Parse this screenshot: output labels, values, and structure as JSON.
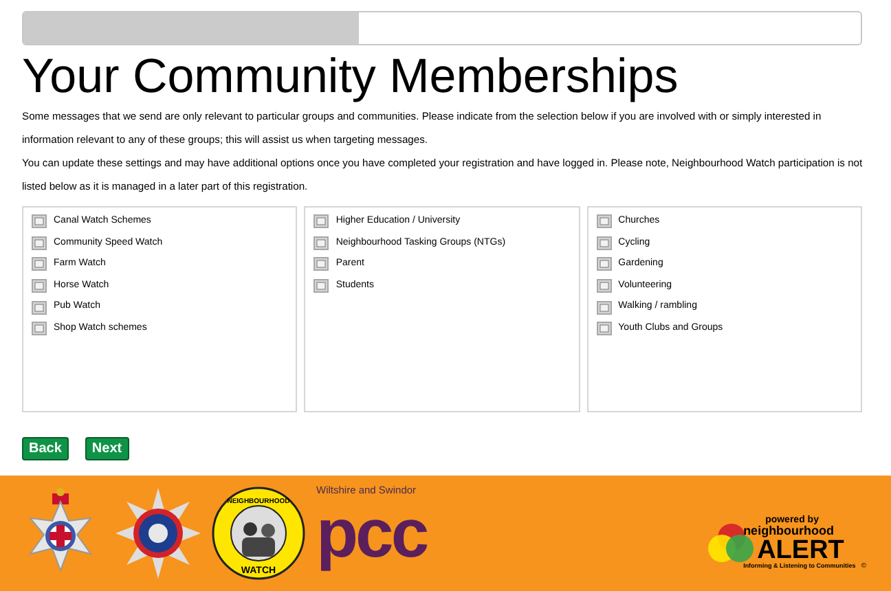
{
  "progress": {
    "level": 0.4
  },
  "title": "Your Community Memberships",
  "paragraphs": [
    "Some messages that we send are only relevant to particular groups and communities. Please indicate from the selection below if you are involved with or simply interested in information relevant to any of these groups; this will assist us when targeting messages.",
    "You can update these settings and may have additional options once you have completed your registration and have logged in. Please note, Neighbourhood Watch participation is not listed below as it is managed in a later part of this registration."
  ],
  "groups": [
    {
      "items": [
        {
          "label": "Canal Watch Schemes",
          "checked": false
        },
        {
          "label": "Community Speed Watch",
          "checked": false
        },
        {
          "label": "Farm Watch",
          "checked": false
        },
        {
          "label": "Horse Watch",
          "checked": false
        },
        {
          "label": "Pub Watch",
          "checked": false
        },
        {
          "label": "Shop Watch schemes",
          "checked": false
        }
      ]
    },
    {
      "items": [
        {
          "label": "Higher Education / University",
          "checked": false
        },
        {
          "label": "Neighbourhood Tasking Groups (NTGs)",
          "checked": false
        },
        {
          "label": "Parent",
          "checked": false
        },
        {
          "label": "Students",
          "checked": false
        }
      ]
    },
    {
      "items": [
        {
          "label": "Churches",
          "checked": false
        },
        {
          "label": "Cycling",
          "checked": false
        },
        {
          "label": "Gardening",
          "checked": false
        },
        {
          "label": "Volunteering",
          "checked": false
        },
        {
          "label": "Walking / rambling",
          "checked": false
        },
        {
          "label": "Youth Clubs and Groups",
          "checked": false
        }
      ]
    }
  ],
  "buttons": [
    "Back",
    "Next"
  ],
  "footer": {
    "watch_logo": [
      "NEIGHBOURHOOD",
      "WATCH"
    ],
    "pcc_logo": {
      "caption": "Wiltshire and Swindor",
      "mark": "pcc"
    },
    "alert_logo": {
      "top": "powered by",
      "middle": "neighbourhood",
      "main": "ALERT",
      "tagline": "Informing & Listening to Communities",
      "symbol": "©"
    }
  }
}
